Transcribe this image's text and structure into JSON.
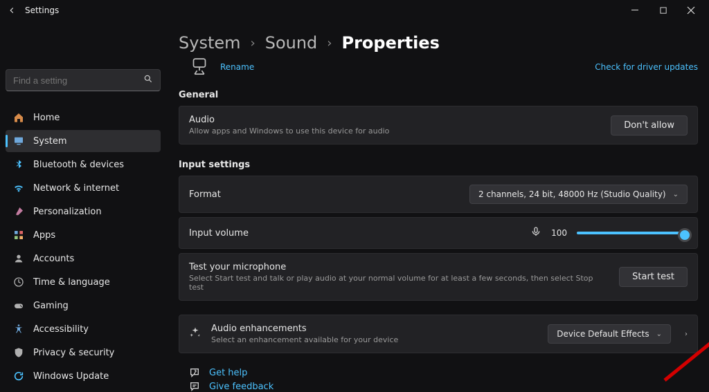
{
  "window": {
    "title": "Settings"
  },
  "search": {
    "placeholder": "Find a setting"
  },
  "sidebar": {
    "items": [
      {
        "label": "Home",
        "icon": "home-icon"
      },
      {
        "label": "System",
        "icon": "system-icon",
        "selected": true
      },
      {
        "label": "Bluetooth & devices",
        "icon": "bluetooth-icon"
      },
      {
        "label": "Network & internet",
        "icon": "wifi-icon"
      },
      {
        "label": "Personalization",
        "icon": "brush-icon"
      },
      {
        "label": "Apps",
        "icon": "apps-icon"
      },
      {
        "label": "Accounts",
        "icon": "person-icon"
      },
      {
        "label": "Time & language",
        "icon": "clock-globe-icon"
      },
      {
        "label": "Gaming",
        "icon": "gaming-icon"
      },
      {
        "label": "Accessibility",
        "icon": "accessibility-icon"
      },
      {
        "label": "Privacy & security",
        "icon": "shield-icon"
      },
      {
        "label": "Windows Update",
        "icon": "update-icon"
      }
    ]
  },
  "breadcrumb": {
    "parts": [
      "System",
      "Sound",
      "Properties"
    ]
  },
  "device": {
    "rename_label": "Rename",
    "check_updates_label": "Check for driver updates"
  },
  "sections": {
    "general_label": "General",
    "input_label": "Input settings"
  },
  "audio_card": {
    "title": "Audio",
    "subtitle": "Allow apps and Windows to use this device for audio",
    "button_label": "Don't allow"
  },
  "format_card": {
    "title": "Format",
    "value": "2 channels, 24 bit, 48000 Hz (Studio Quality)"
  },
  "volume_card": {
    "title": "Input volume",
    "value": "100"
  },
  "test_card": {
    "title": "Test your microphone",
    "subtitle": "Select Start test and talk or play audio at your normal volume for at least a few seconds, then select Stop test",
    "button_label": "Start test"
  },
  "enhancements_card": {
    "title": "Audio enhancements",
    "subtitle": "Select an enhancement available for your device",
    "dropdown_value": "Device Default Effects"
  },
  "footer_links": {
    "help": "Get help",
    "feedback": "Give feedback"
  }
}
